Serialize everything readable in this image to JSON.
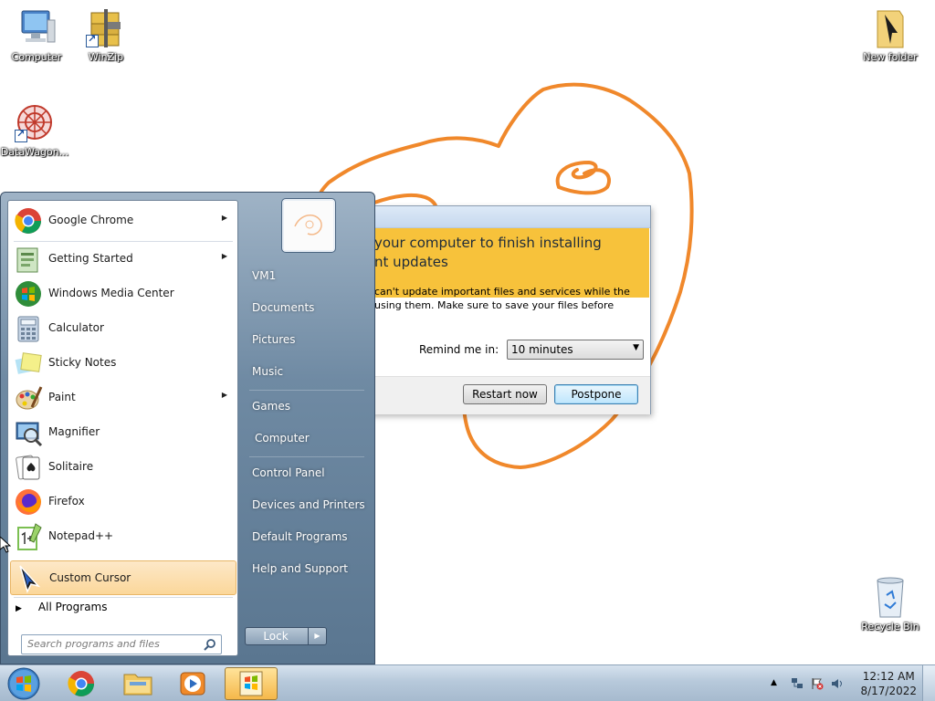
{
  "desktop": {
    "icons": [
      {
        "label": "Computer",
        "icon": "computer-icon"
      },
      {
        "label": "WinZip",
        "icon": "winzip-icon"
      },
      {
        "label": "DataWagon...",
        "icon": "datawagon-icon"
      },
      {
        "label": "New folder",
        "icon": "folder-icon"
      },
      {
        "label": "Recycle Bin",
        "icon": "recycle-bin-icon"
      }
    ]
  },
  "dialog": {
    "headline_line1": "your computer to finish installing",
    "headline_line2": "nt updates",
    "body_line1": "can't update important files and services while the",
    "body_line2": "using them. Make sure to save your files before",
    "remind_label": "Remind me in:",
    "remind_value": "10 minutes",
    "restart_label": "Restart now",
    "postpone_label": "Postpone",
    "accent_color": "#f7c23b"
  },
  "start_menu": {
    "programs": [
      {
        "label": "Google Chrome",
        "icon": "chrome-icon",
        "has_submenu": true
      },
      {
        "label": "Getting Started",
        "icon": "getting-started-icon",
        "has_submenu": true
      },
      {
        "label": "Windows Media Center",
        "icon": "media-center-icon",
        "has_submenu": false
      },
      {
        "label": "Calculator",
        "icon": "calculator-icon",
        "has_submenu": false
      },
      {
        "label": "Sticky Notes",
        "icon": "sticky-notes-icon",
        "has_submenu": false
      },
      {
        "label": "Paint",
        "icon": "paint-icon",
        "has_submenu": true
      },
      {
        "label": "Magnifier",
        "icon": "magnifier-icon",
        "has_submenu": false
      },
      {
        "label": "Solitaire",
        "icon": "solitaire-icon",
        "has_submenu": false
      },
      {
        "label": "Firefox",
        "icon": "firefox-icon",
        "has_submenu": false
      },
      {
        "label": "Notepad++",
        "icon": "notepadpp-icon",
        "has_submenu": false
      },
      {
        "label": "Custom Cursor",
        "icon": "custom-cursor-icon",
        "has_submenu": false,
        "highlighted": true
      }
    ],
    "all_programs": "All Programs",
    "search_placeholder": "Search programs and files",
    "right_links": [
      "VM1",
      "Documents",
      "Pictures",
      "Music",
      "Games",
      "Computer",
      "Control Panel",
      "Devices and Printers",
      "Default Programs",
      "Help and Support"
    ],
    "lock_label": "Lock"
  },
  "taskbar": {
    "items": [
      "start-orb-icon",
      "chrome-icon",
      "explorer-icon",
      "media-player-icon",
      "windows-update-icon"
    ],
    "time": "12:12 AM",
    "date": "8/17/2022"
  }
}
